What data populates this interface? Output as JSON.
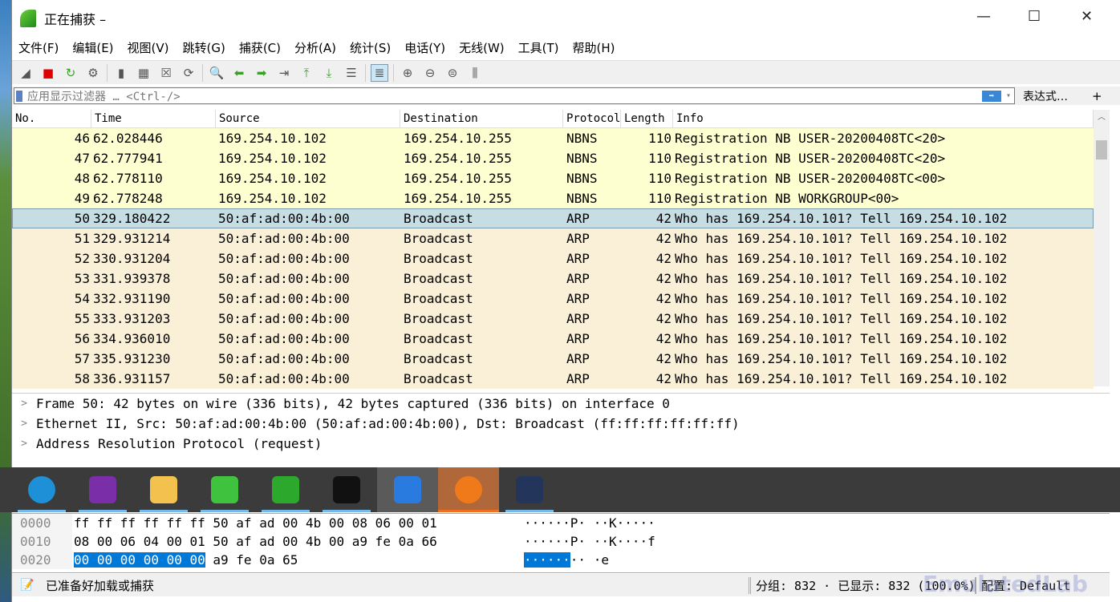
{
  "window": {
    "title": "正在捕获 –",
    "minimize": "—",
    "maximize": "☐",
    "close": "✕"
  },
  "menu": [
    "文件(F)",
    "编辑(E)",
    "视图(V)",
    "跳转(G)",
    "捕获(C)",
    "分析(A)",
    "统计(S)",
    "电话(Y)",
    "无线(W)",
    "工具(T)",
    "帮助(H)"
  ],
  "toolbar": [
    "shark-fin-icon",
    "stop-icon",
    "restart-icon",
    "options-icon",
    "open-icon",
    "save-icon",
    "close-file-icon",
    "reload-icon",
    "find-icon",
    "back-icon",
    "forward-icon",
    "goto-icon",
    "first-icon",
    "last-icon",
    "autoscroll-icon",
    "colorize-icon",
    "zoom-in-icon",
    "zoom-out-icon",
    "zoom-reset-icon",
    "resize-columns-icon"
  ],
  "filter": {
    "placeholder": "应用显示过滤器 … <Ctrl-/>",
    "expression_label": "表达式…",
    "add_label": "+"
  },
  "columns": [
    "No.",
    "Time",
    "Source",
    "Destination",
    "Protocol",
    "Length",
    "Info"
  ],
  "packets": [
    {
      "no": "46",
      "time": "62.028446",
      "src": "169.254.10.102",
      "dst": "169.254.10.255",
      "proto": "NBNS",
      "len": "110",
      "info": "Registration NB USER-20200408TC<20>",
      "type": "nbns"
    },
    {
      "no": "47",
      "time": "62.777941",
      "src": "169.254.10.102",
      "dst": "169.254.10.255",
      "proto": "NBNS",
      "len": "110",
      "info": "Registration NB USER-20200408TC<20>",
      "type": "nbns"
    },
    {
      "no": "48",
      "time": "62.778110",
      "src": "169.254.10.102",
      "dst": "169.254.10.255",
      "proto": "NBNS",
      "len": "110",
      "info": "Registration NB USER-20200408TC<00>",
      "type": "nbns"
    },
    {
      "no": "49",
      "time": "62.778248",
      "src": "169.254.10.102",
      "dst": "169.254.10.255",
      "proto": "NBNS",
      "len": "110",
      "info": "Registration NB WORKGROUP<00>",
      "type": "nbns"
    },
    {
      "no": "50",
      "time": "329.180422",
      "src": "50:af:ad:00:4b:00",
      "dst": "Broadcast",
      "proto": "ARP",
      "len": "42",
      "info": "Who has 169.254.10.101? Tell 169.254.10.102",
      "type": "sel"
    },
    {
      "no": "51",
      "time": "329.931214",
      "src": "50:af:ad:00:4b:00",
      "dst": "Broadcast",
      "proto": "ARP",
      "len": "42",
      "info": "Who has 169.254.10.101? Tell 169.254.10.102",
      "type": "arp"
    },
    {
      "no": "52",
      "time": "330.931204",
      "src": "50:af:ad:00:4b:00",
      "dst": "Broadcast",
      "proto": "ARP",
      "len": "42",
      "info": "Who has 169.254.10.101? Tell 169.254.10.102",
      "type": "arp"
    },
    {
      "no": "53",
      "time": "331.939378",
      "src": "50:af:ad:00:4b:00",
      "dst": "Broadcast",
      "proto": "ARP",
      "len": "42",
      "info": "Who has 169.254.10.101? Tell 169.254.10.102",
      "type": "arp"
    },
    {
      "no": "54",
      "time": "332.931190",
      "src": "50:af:ad:00:4b:00",
      "dst": "Broadcast",
      "proto": "ARP",
      "len": "42",
      "info": "Who has 169.254.10.101? Tell 169.254.10.102",
      "type": "arp"
    },
    {
      "no": "55",
      "time": "333.931203",
      "src": "50:af:ad:00:4b:00",
      "dst": "Broadcast",
      "proto": "ARP",
      "len": "42",
      "info": "Who has 169.254.10.101? Tell 169.254.10.102",
      "type": "arp"
    },
    {
      "no": "56",
      "time": "334.936010",
      "src": "50:af:ad:00:4b:00",
      "dst": "Broadcast",
      "proto": "ARP",
      "len": "42",
      "info": "Who has 169.254.10.101? Tell 169.254.10.102",
      "type": "arp"
    },
    {
      "no": "57",
      "time": "335.931230",
      "src": "50:af:ad:00:4b:00",
      "dst": "Broadcast",
      "proto": "ARP",
      "len": "42",
      "info": "Who has 169.254.10.101? Tell 169.254.10.102",
      "type": "arp"
    },
    {
      "no": "58",
      "time": "336.931157",
      "src": "50:af:ad:00:4b:00",
      "dst": "Broadcast",
      "proto": "ARP",
      "len": "42",
      "info": "Who has 169.254.10.101? Tell 169.254.10.102",
      "type": "arp"
    }
  ],
  "details": [
    "Frame 50: 42 bytes on wire (336 bits), 42 bytes captured (336 bits) on interface 0",
    "Ethernet II, Src: 50:af:ad:00:4b:00 (50:af:ad:00:4b:00), Dst: Broadcast (ff:ff:ff:ff:ff:ff)",
    "Address Resolution Protocol (request)"
  ],
  "taskbar": [
    {
      "name": "edge",
      "color": "#1e90d8"
    },
    {
      "name": "onenote",
      "color": "#7a2fa8"
    },
    {
      "name": "file-explorer",
      "color": "#f2c14e"
    },
    {
      "name": "wechat",
      "color": "#3fc33f"
    },
    {
      "name": "eye-app",
      "color": "#2ca82c"
    },
    {
      "name": "terminal",
      "color": "#111111"
    },
    {
      "name": "wireshark",
      "color": "#2a7be0"
    },
    {
      "name": "firefox",
      "color": "#f07a1a"
    },
    {
      "name": "cat-app",
      "color": "#23355a"
    }
  ],
  "hex": {
    "rows": [
      {
        "offset": "0000",
        "hl": "",
        "bytes": "ff ff ff ff ff ff 50 af  ad 00 4b 00 08 06 00 01",
        "ascii_hl": "",
        "ascii": "······P· ··K·····"
      },
      {
        "offset": "0010",
        "hl": "",
        "bytes": "08 00 06 04 00 01 50 af  ad 00 4b 00 a9 fe 0a 66",
        "ascii_hl": "",
        "ascii": "······P· ··K····f"
      },
      {
        "offset": "0020",
        "hl": "00 00 00 00 00 00",
        "bytes": " a9 fe  0a 65",
        "ascii_hl": "······",
        "ascii": "·· ·e"
      }
    ]
  },
  "status": {
    "text": "已准备好加载或捕获",
    "packets": "分组: 832 · 已显示: 832 (100.0%)",
    "profile": "配置: Default"
  },
  "watermark": "EmulatedLab",
  "colors": {
    "nbns_row": "#feffd0",
    "arp_row": "#faf0d7",
    "selected_row": "#c6dde4",
    "hex_highlight": "#0078d7"
  }
}
